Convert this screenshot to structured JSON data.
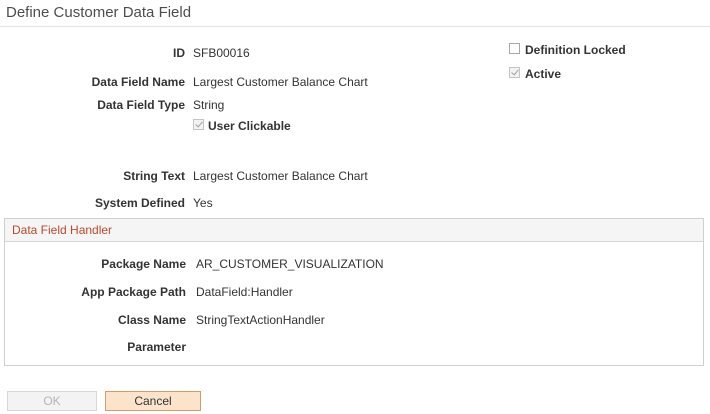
{
  "page": {
    "title": "Define Customer Data Field"
  },
  "fields": {
    "id_label": "ID",
    "id_value": "SFB00016",
    "name_label": "Data Field Name",
    "name_value": "Largest Customer Balance Chart",
    "type_label": "Data Field Type",
    "type_value": "String",
    "user_clickable_label": "User Clickable",
    "user_clickable_checked": true,
    "string_text_label": "String Text",
    "string_text_value": "Largest Customer Balance Chart",
    "system_defined_label": "System Defined",
    "system_defined_value": "Yes"
  },
  "flags": {
    "definition_locked_label": "Definition Locked",
    "definition_locked_checked": false,
    "active_label": "Active",
    "active_checked": true
  },
  "handler": {
    "title": "Data Field Handler",
    "package_name_label": "Package Name",
    "package_name_value": "AR_CUSTOMER_VISUALIZATION",
    "app_package_path_label": "App Package Path",
    "app_package_path_value": "DataField:Handler",
    "class_name_label": "Class Name",
    "class_name_value": "StringTextActionHandler",
    "parameter_label": "Parameter",
    "parameter_value": ""
  },
  "buttons": {
    "ok": "OK",
    "cancel": "Cancel"
  }
}
